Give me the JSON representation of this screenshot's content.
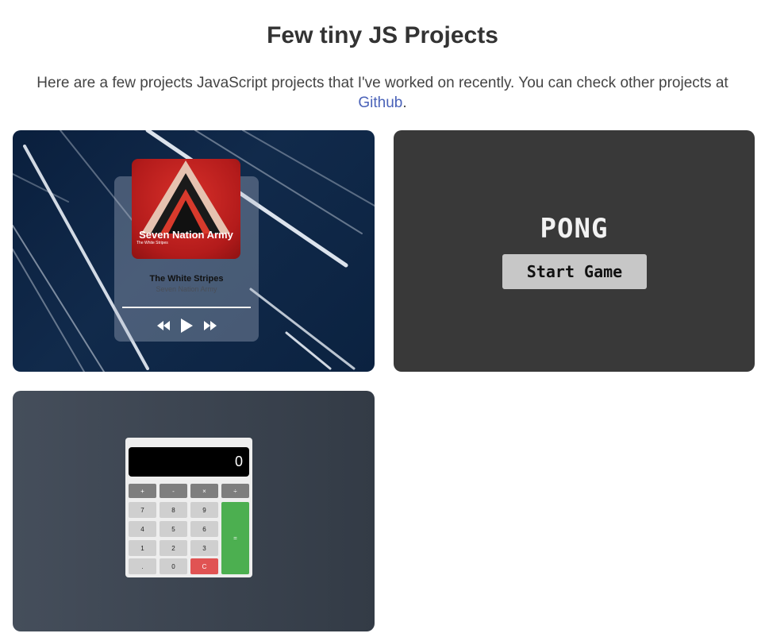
{
  "header": {
    "title": "Few tiny JS Projects",
    "intro_text": "Here are a few projects JavaScript projects that I've worked on recently. You can check other projects at",
    "github_link": "Github",
    "intro_end": "."
  },
  "projects": {
    "music": {
      "album_title": "Seven Nation Army",
      "album_subtitle": "The White Stripes",
      "artist": "The White Stripes",
      "song": "Seven Nation Army",
      "prev_icon": "rewind-icon",
      "play_icon": "play-icon",
      "next_icon": "fast-forward-icon"
    },
    "pong": {
      "title": "PONG",
      "start_label": "Start Game"
    },
    "calculator": {
      "display": "0",
      "operators": [
        "+",
        "-",
        "×",
        "÷"
      ],
      "digits_row1": [
        "7",
        "8",
        "9"
      ],
      "digits_row2": [
        "4",
        "5",
        "6"
      ],
      "digits_row3": [
        "1",
        "2",
        "3"
      ],
      "bottom_row": [
        ".",
        "0",
        "C"
      ],
      "equals": "="
    }
  },
  "colors": {
    "link": "#4a62b8",
    "pong_bg": "#393939",
    "calc_equals": "#4caf50",
    "calc_clear": "#e05353"
  }
}
